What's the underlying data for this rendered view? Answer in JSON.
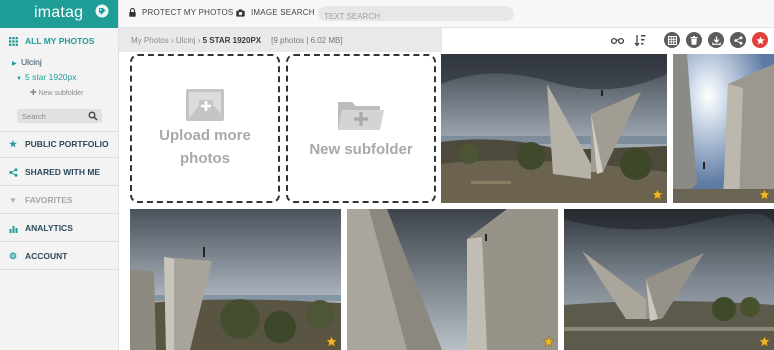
{
  "app": {
    "logo": "imatag"
  },
  "sidebar": {
    "all_photos": "ALL MY PHOTOS",
    "tree": [
      {
        "label": "Ulcinj"
      },
      {
        "label": "5 star 1920px"
      }
    ],
    "new_subfolder": "New subfolder",
    "search_placeholder": "Search",
    "items": [
      {
        "label": "PUBLIC PORTFOLIO",
        "icon": "star-icon"
      },
      {
        "label": "SHARED WITH ME",
        "icon": "share-icon"
      },
      {
        "label": "FAVORITES",
        "icon": "heart-icon"
      },
      {
        "label": "ANALYTICS",
        "icon": "bar-chart-icon"
      },
      {
        "label": "ACCOUNT",
        "icon": "gear-icon"
      }
    ]
  },
  "topbar": {
    "protect": "PROTECT MY PHOTOS",
    "image_search": "IMAGE SEARCH",
    "search_placeholder": "TEXT SEARCH"
  },
  "breadcrumb": {
    "root": "My Photos",
    "sep1": " › ",
    "folder": "Ulcinj",
    "sep2": " › ",
    "current": "5 STAR 1920PX",
    "meta": "[9 photos | 6.02 MB]"
  },
  "tiles": {
    "upload": "Upload more photos",
    "upload_line1": "Upload more",
    "upload_line2": "photos",
    "new_subfolder": "New subfolder"
  },
  "colors": {
    "brand": "#1f9e98",
    "accent_red": "#e2403a",
    "star": "#f0b429"
  }
}
